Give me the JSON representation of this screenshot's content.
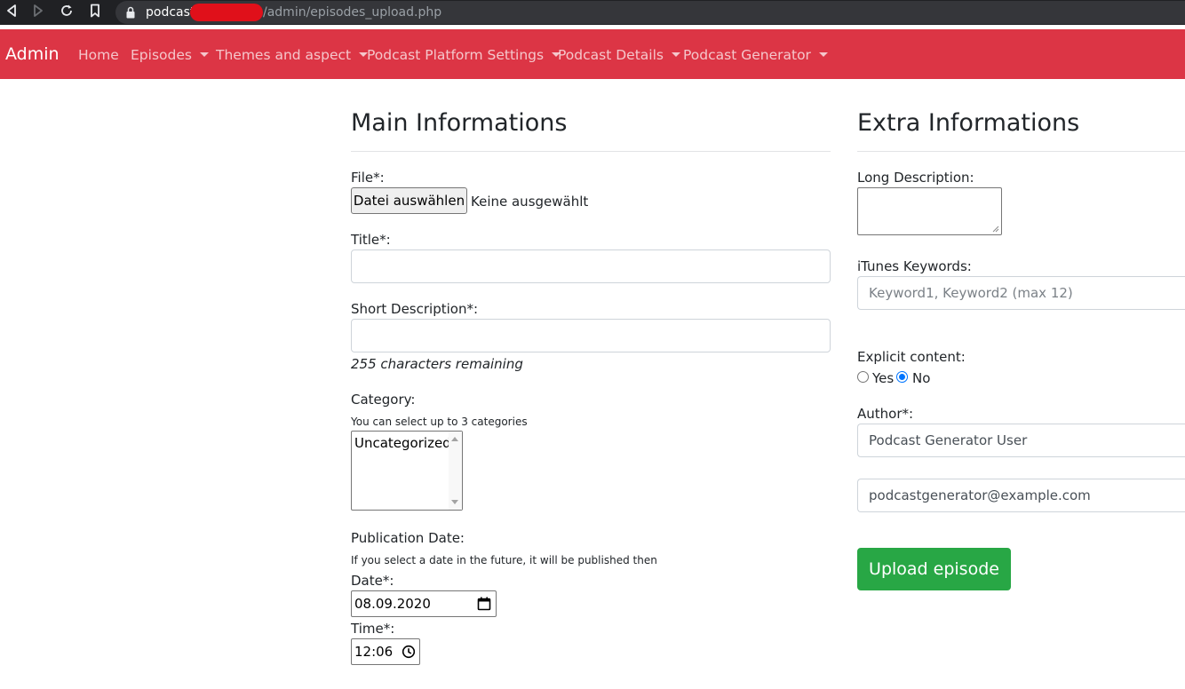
{
  "browser": {
    "url_host": "podcast.",
    "url_path": "/admin/episodes_upload.php"
  },
  "navbar": {
    "brand": "Admin",
    "items": [
      {
        "label": "Home"
      },
      {
        "label": "Episodes"
      },
      {
        "label": "Themes and aspect"
      },
      {
        "label": "Podcast Platform Settings"
      },
      {
        "label": "Podcast Details"
      },
      {
        "label": "Podcast Generator"
      }
    ]
  },
  "main": {
    "heading": "Main Informations",
    "file_label": "File*:",
    "file_button": "Datei auswählen",
    "file_status": "Keine ausgewählt",
    "title_label": "Title*:",
    "title_value": "",
    "short_desc_label": "Short Description*:",
    "short_desc_value": "",
    "chars_remaining": "255 characters remaining",
    "category_label": "Category:",
    "category_help": "You can select up to 3 categories",
    "category_options": [
      "Uncategorized"
    ],
    "pubdate_label": "Publication Date:",
    "pubdate_help": "If you select a date in the future, it will be published then",
    "date_label": "Date*:",
    "date_value": "08.09.2020",
    "time_label": "Time*:",
    "time_value": "12:06"
  },
  "extra": {
    "heading": "Extra Informations",
    "long_desc_label": "Long Description:",
    "long_desc_value": "",
    "keywords_label": "iTunes Keywords:",
    "keywords_placeholder": "Keyword1, Keyword2 (max 12)",
    "explicit_label": "Explicit content:",
    "explicit_yes": "Yes",
    "explicit_no": "No",
    "explicit_selected": "No",
    "author_label": "Author*:",
    "author_name": "Podcast Generator User",
    "author_email": "podcastgenerator@example.com",
    "upload_button": "Upload episode"
  },
  "colors": {
    "navbar_bg": "#dc3545",
    "button_success": "#28a745",
    "radio_accent": "#0075ff"
  }
}
